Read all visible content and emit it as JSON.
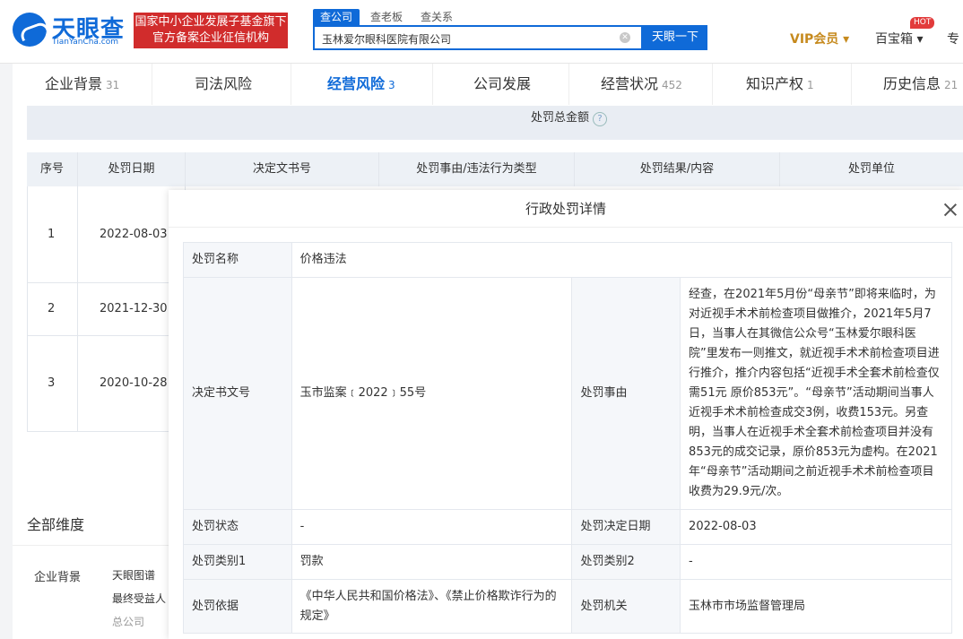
{
  "header": {
    "logo_text": "天眼查",
    "logo_sub": "TianYanCha.com",
    "promo_line1": "国家中小企业发展子基金旗下",
    "promo_line2": "官方备案企业征信机构",
    "search_tabs": [
      "查公司",
      "查老板",
      "查关系"
    ],
    "search_value": "玉林爱尔眼科医院有限公司",
    "search_button": "天眼一下",
    "vip_label": "VIP会员 ▾",
    "baobao_label": "百宝箱 ▾",
    "hot_badge": "HOT",
    "more_label": "专"
  },
  "nav": [
    {
      "label": "企业背景",
      "count": "31"
    },
    {
      "label": "司法风险",
      "count": ""
    },
    {
      "label": "经营风险",
      "count": "3"
    },
    {
      "label": "公司发展",
      "count": ""
    },
    {
      "label": "经营状况",
      "count": "452"
    },
    {
      "label": "知识产权",
      "count": "1"
    },
    {
      "label": "历史信息",
      "count": "21"
    }
  ],
  "penalty_total_label": "处罚总金额",
  "table": {
    "headers": [
      "序号",
      "处罚日期",
      "决定文书号",
      "处罚事由/违法行为类型",
      "处罚结果/内容",
      "处罚单位"
    ],
    "rows": [
      {
        "no": "1",
        "date": "2022-08-03"
      },
      {
        "no": "2",
        "date": "2021-12-30"
      },
      {
        "no": "3",
        "date": "2020-10-28"
      }
    ]
  },
  "dimensions": {
    "title": "全部维度",
    "category": "企业背景",
    "links": [
      "天眼图谱",
      "最终受益人",
      "总公司"
    ]
  },
  "modal": {
    "title": "行政处罚详情",
    "name_label": "处罚名称",
    "name_value": "价格违法",
    "doc_label": "决定书文号",
    "doc_value": "玉市监案﹝2022﹞55号",
    "reason_label": "处罚事由",
    "reason_value": "经查，在2021年5月份“母亲节”即将来临时，为对近视手术术前检查项目做推介，2021年5月7日，当事人在其微信公众号“玉林爱尔眼科医院”里发布一则推文，就近视手术术前检查项目进行推介，推介内容包括“近视手术全套术前检查仅需51元 原价853元”。“母亲节”活动期间当事人近视手术术前检查成交3例，收费153元。另查明，当事人在近视手术全套术前检查项目并没有853元的成交记录，原价853元为虚构。在2021年“母亲节”活动期间之前近视手术术前检查项目收费为29.9元/次。",
    "status_label": "处罚状态",
    "status_value": "-",
    "date_label": "处罚决定日期",
    "date_value": "2022-08-03",
    "cat1_label": "处罚类别1",
    "cat1_value": "罚款",
    "cat2_label": "处罚类别2",
    "cat2_value": "-",
    "basis_label": "处罚依据",
    "basis_value": "《中华人民共和国价格法》、《禁止价格欺诈行为的规定》",
    "authority_label": "处罚机关",
    "authority_value": "玉林市市场监督管理局"
  }
}
